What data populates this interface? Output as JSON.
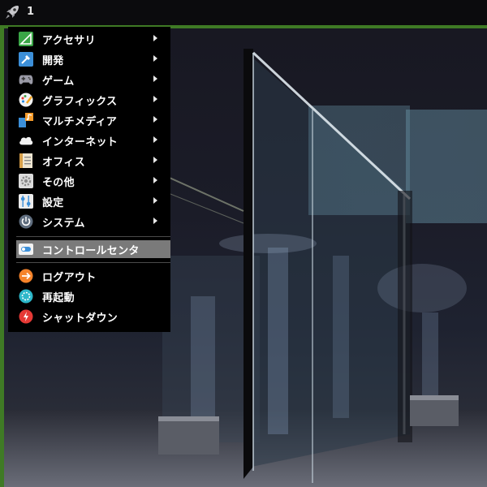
{
  "panel": {
    "launcher_icon": "rocket-icon",
    "workspace_number": "1",
    "accent_color": "#3f7a25"
  },
  "menu": {
    "categories": [
      {
        "label": "アクセサリ",
        "icon": "accessories-icon"
      },
      {
        "label": "開発",
        "icon": "development-icon"
      },
      {
        "label": "ゲーム",
        "icon": "gamepad-icon"
      },
      {
        "label": "グラフィックス",
        "icon": "graphics-icon"
      },
      {
        "label": "マルチメディア",
        "icon": "multimedia-icon"
      },
      {
        "label": "インターネット",
        "icon": "cloud-icon"
      },
      {
        "label": "オフィス",
        "icon": "office-icon"
      },
      {
        "label": "その他",
        "icon": "gear-icon"
      },
      {
        "label": "設定",
        "icon": "settings-icon"
      },
      {
        "label": "システム",
        "icon": "power-icon"
      }
    ],
    "control_center": {
      "label": "コントロールセンタ",
      "icon": "control-center-icon"
    },
    "session": [
      {
        "label": "ログアウト",
        "icon": "logout-icon"
      },
      {
        "label": "再起動",
        "icon": "restart-icon"
      },
      {
        "label": "シャットダウン",
        "icon": "shutdown-icon"
      }
    ]
  }
}
